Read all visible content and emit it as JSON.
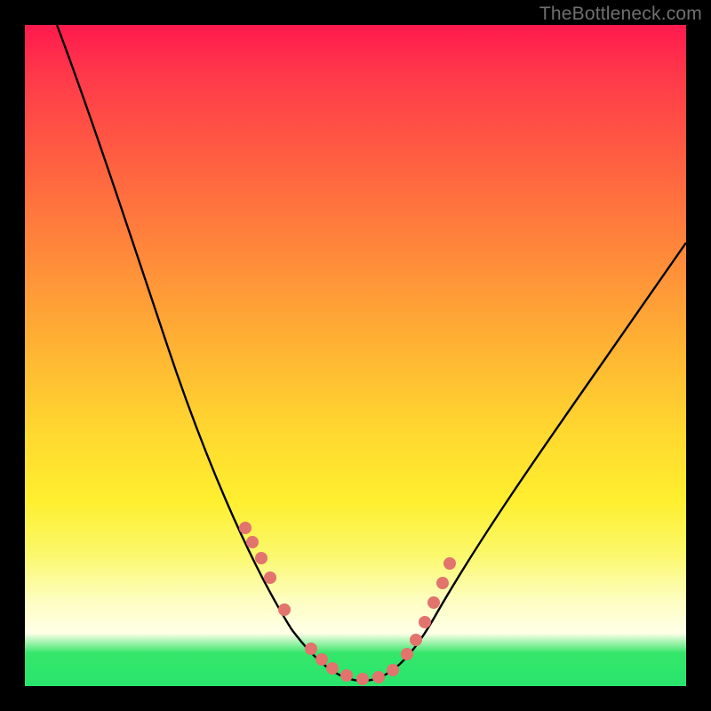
{
  "watermark": "TheBottleneck.com",
  "chart_data": {
    "type": "line",
    "title": "",
    "xlabel": "",
    "ylabel": "",
    "xlim": [
      0,
      100
    ],
    "ylim": [
      0,
      100
    ],
    "grid": false,
    "series": [
      {
        "name": "bottleneck-curve",
        "x": [
          5,
          10,
          15,
          20,
          25,
          30,
          35,
          38,
          40,
          43,
          46,
          48,
          50,
          53,
          55,
          58,
          62,
          68,
          75,
          82,
          90,
          97,
          100
        ],
        "values": [
          100,
          89,
          77,
          65,
          53,
          41,
          30,
          22,
          16,
          10,
          5,
          2,
          1,
          1,
          2,
          4,
          8,
          14,
          22,
          31,
          41,
          50,
          54
        ]
      },
      {
        "name": "marker-dots",
        "type": "scatter",
        "x": [
          32,
          33,
          35,
          37,
          40,
          44,
          45,
          46,
          48,
          50,
          52,
          54,
          56,
          57,
          58,
          59
        ],
        "values": [
          25,
          23,
          20,
          17,
          12,
          5,
          4,
          3,
          2,
          1.5,
          2,
          3,
          5,
          8,
          11,
          14
        ]
      }
    ],
    "gradient_stops": [
      {
        "pos": 0,
        "color": "#ff1a4d"
      },
      {
        "pos": 35,
        "color": "#ff8a3a"
      },
      {
        "pos": 62,
        "color": "#ffd92f"
      },
      {
        "pos": 87,
        "color": "#fdfec0"
      },
      {
        "pos": 95,
        "color": "#35e66a"
      },
      {
        "pos": 100,
        "color": "#29e56d"
      }
    ]
  }
}
